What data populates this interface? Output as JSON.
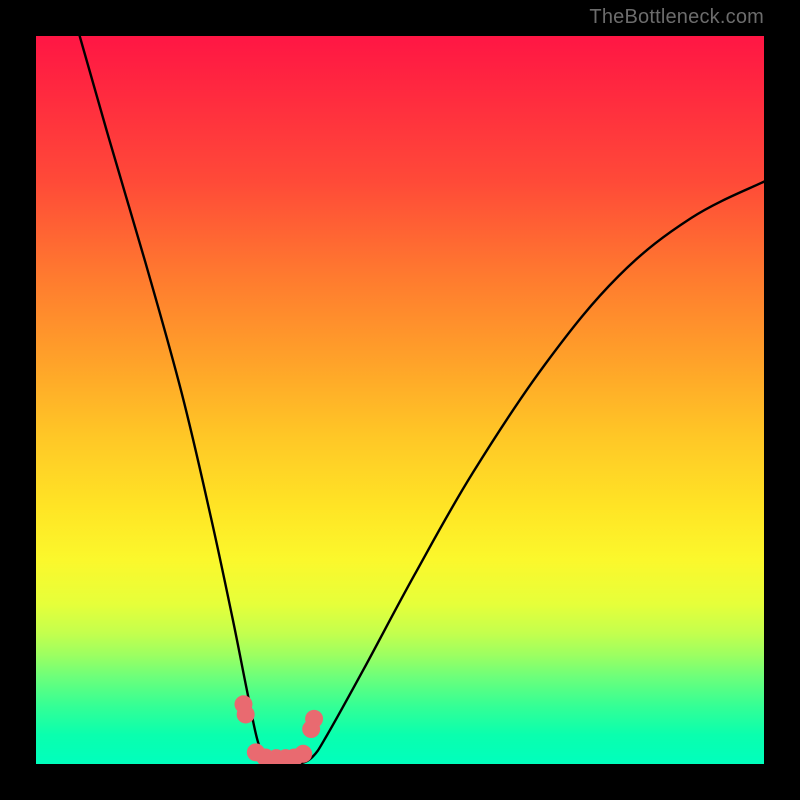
{
  "watermark": "TheBottleneck.com",
  "chart_data": {
    "type": "line",
    "title": "",
    "xlabel": "",
    "ylabel": "",
    "xlim": [
      0,
      100
    ],
    "ylim": [
      0,
      100
    ],
    "series": [
      {
        "name": "v-curve",
        "x": [
          6,
          10,
          15,
          20,
          24,
          27,
          29,
          30.5,
          32,
          34,
          36,
          38,
          40,
          45,
          52,
          60,
          70,
          80,
          90,
          100
        ],
        "values": [
          100,
          86,
          69,
          51,
          34,
          20,
          10,
          3,
          0,
          0,
          0,
          1,
          4,
          13,
          26,
          40,
          55,
          67,
          75,
          80
        ]
      },
      {
        "name": "dots",
        "x": [
          28.5,
          28.8,
          30.2,
          31.5,
          33,
          34.3,
          35.5,
          36.7,
          37.8,
          38.2
        ],
        "values": [
          8.2,
          6.8,
          1.6,
          0.9,
          0.8,
          0.8,
          0.9,
          1.4,
          4.8,
          6.2
        ]
      }
    ],
    "colors": {
      "curve": "#000000",
      "dots": "#e96a70",
      "gradient_top": "#ff1644",
      "gradient_bottom": "#00ffbd",
      "frame": "#000000",
      "watermark": "#6c6c6c"
    }
  }
}
